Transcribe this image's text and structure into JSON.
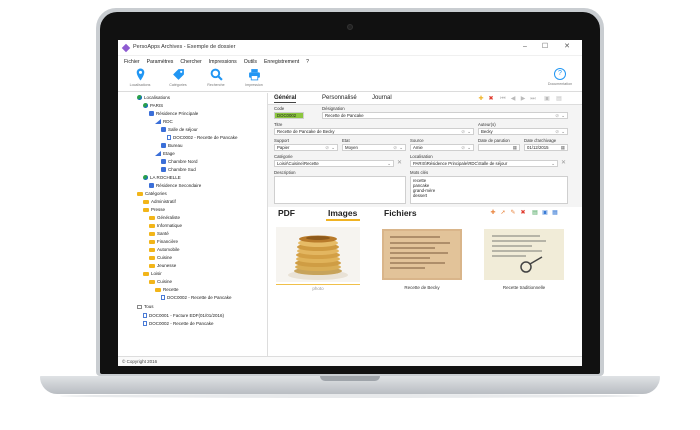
{
  "window": {
    "title": "PersoApps Archives - Exemple de dossier",
    "controls": [
      "–",
      "☐",
      "✕"
    ]
  },
  "menu": [
    "Fichier",
    "Paramètres",
    "Chercher",
    "Impressions",
    "Outils",
    "Enregistrement",
    "?"
  ],
  "toolbar": {
    "buttons": [
      {
        "label": "Localisations",
        "icon": "pin-icon"
      },
      {
        "label": "Catégories",
        "icon": "tag-icon"
      },
      {
        "label": "Recherche",
        "icon": "magnifier-icon"
      },
      {
        "label": "Impression",
        "icon": "printer-icon"
      }
    ],
    "help": {
      "label": "Documentation",
      "icon": "help-icon",
      "glyph": "?"
    }
  },
  "tree": {
    "items": [
      {
        "text": "Localisations",
        "icon": "globe"
      },
      {
        "text": "PARIS",
        "icon": "globe"
      },
      {
        "text": "Résidence Principale",
        "icon": "building"
      },
      {
        "text": "RDC",
        "icon": "floor"
      },
      {
        "text": "Salle de séjour",
        "icon": "room"
      },
      {
        "text": "DOC0002 - Recette de Pancake",
        "icon": "doc"
      },
      {
        "text": "Bureau",
        "icon": "room"
      },
      {
        "text": "Etage",
        "icon": "floor"
      },
      {
        "text": "Chambre Nord",
        "icon": "room"
      },
      {
        "text": "Chambre Sud",
        "icon": "room"
      },
      {
        "text": "LA ROCHELLE",
        "icon": "globe"
      },
      {
        "text": "Résidence Secondaire",
        "icon": "building"
      },
      {
        "text": "Catégories",
        "icon": "folder"
      },
      {
        "text": "Administratif",
        "icon": "folder"
      },
      {
        "text": "Presse",
        "icon": "folder"
      },
      {
        "text": "Généraliste",
        "icon": "folder"
      },
      {
        "text": "Informatique",
        "icon": "folder"
      },
      {
        "text": "Santé",
        "icon": "folder"
      },
      {
        "text": "Financière",
        "icon": "folder"
      },
      {
        "text": "Automobile",
        "icon": "folder"
      },
      {
        "text": "Cuisine",
        "icon": "folder"
      },
      {
        "text": "Jeunesse",
        "icon": "folder"
      },
      {
        "text": "Loisir",
        "icon": "folder"
      },
      {
        "text": "Cuisine",
        "icon": "folder"
      },
      {
        "text": "Recette",
        "icon": "folder"
      },
      {
        "text": "DOC0002 - Recette de Pancake",
        "icon": "doc"
      },
      {
        "text": "Tous",
        "icon": "tous"
      },
      {
        "text": "DOC0001 - Facture EDF(01/01/2016)",
        "icon": "doc"
      },
      {
        "text": "DOC0002 - Recette de Pancake",
        "icon": "doc"
      }
    ]
  },
  "detail": {
    "tabs": [
      "Général",
      "Personnalisé",
      "Journal"
    ],
    "labels": {
      "code": "Code",
      "designation": "Désignation",
      "titre": "Titre",
      "auteurs": "Auteur(s)",
      "support": "Support",
      "etat": "Etat",
      "source": "Source",
      "date_parution": "Date de parution",
      "date_archivage": "Date d'archivage",
      "categorie": "Catégorie",
      "localisation": "Localisation",
      "description": "Description",
      "mots_cles": "Mots clés"
    },
    "values": {
      "code": "DOC0002",
      "designation": "Recette de Pancake",
      "titre": "Recette de Pancake de Becky",
      "auteurs": "Becky",
      "support": "Papier",
      "etat": "Moyen",
      "source": "Amie",
      "date_parution": "",
      "date_archivage": "01/12/2015",
      "categorie": "Loisir\\Cuisine\\Recette",
      "localisation": "PARIS\\Résidence Principale\\RDC\\Salle de séjour",
      "description": ""
    },
    "keywords": [
      "recette",
      "pancake",
      "grand-mère",
      "dessert"
    ]
  },
  "attachments": {
    "tabs": [
      "PDF",
      "Images",
      "Fichiers"
    ],
    "items": [
      {
        "label": "photo"
      },
      {
        "label": "Recette de Becky"
      },
      {
        "label": "Recette traditionnelle"
      }
    ]
  },
  "status": {
    "text": "© Copyright 2016"
  },
  "colors": {
    "accent": "#f0b323",
    "code_bg": "#8cc63f",
    "toolbar_icon": "#2196f3"
  }
}
